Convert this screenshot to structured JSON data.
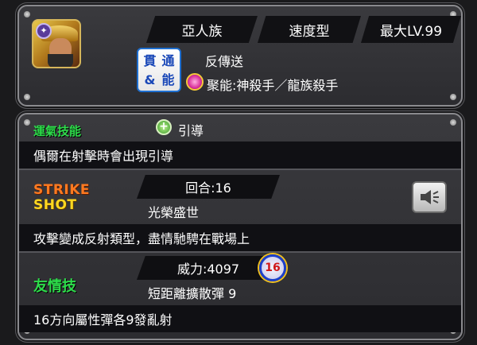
{
  "character": {
    "portrait_badge": "✦",
    "tags": [
      "亞人族",
      "速度型",
      "最大LV.99"
    ],
    "gimmick_chars": [
      "貫",
      "通",
      "&",
      "能"
    ],
    "gimmick_name": "反傳送",
    "nouryoku": "聚能:神殺手／龍族殺手"
  },
  "luck_skill": {
    "title": "運氣技能",
    "name": "引導",
    "description": "偶爾在射擊時會出現引導"
  },
  "strike_shot": {
    "label_line1": "STRIKE",
    "label_line2": "SHOT",
    "turns": "回合:16",
    "name": "光榮盛世",
    "description": "攻擊變成反射類型，盡情馳騁在戰場上"
  },
  "friend_skill": {
    "label": "友情技",
    "power": "威力:4097",
    "badge": "16",
    "name": "短距離擴散彈 9",
    "description": "16方向屬性彈各9發亂射"
  },
  "colors": {
    "accent_green": "#2ddc4a",
    "strike_orange": "#ff7a20",
    "shot_yellow": "#ffd820",
    "gimmick_blue": "#1a48b8"
  }
}
